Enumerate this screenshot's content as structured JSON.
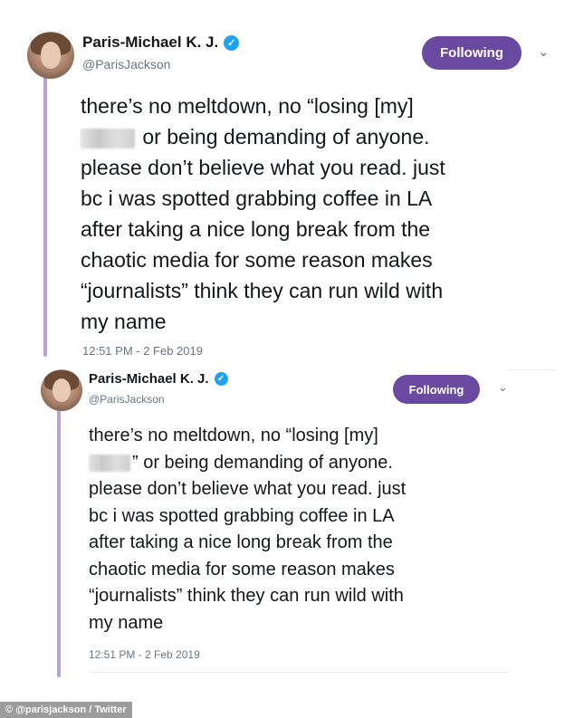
{
  "tweets": [
    {
      "display_name": "Paris-Michael K. J.",
      "handle": "@ParisJackson",
      "follow_label": "Following",
      "lines": [
        "there’s no meltdown, no “losing [my]",
        " or being demanding of anyone.",
        "please don’t believe what you read. just",
        "bc i was spotted grabbing coffee in LA",
        "after taking a nice long break from the",
        "chaotic media for some reason makes",
        "“journalists” think they can run wild with",
        "my name"
      ],
      "timestamp": "12:51 PM - 2 Feb 2019"
    },
    {
      "display_name": "Paris-Michael K. J.",
      "handle": "@ParisJackson",
      "follow_label": "Following",
      "lines": [
        "there’s no meltdown, no “losing [my]",
        "” or being demanding of anyone.",
        "please don’t believe what you read. just",
        "bc i was spotted grabbing coffee in LA",
        "after taking a nice long break from the",
        "chaotic media for some reason makes",
        "“journalists” think they can run wild with",
        "my name"
      ],
      "timestamp": "12:51 PM - 2 Feb 2019"
    }
  ],
  "credit": "© @parisjackson / Twitter",
  "icons": {
    "verified": "verified-badge-icon",
    "chevron": "chevron-down-icon"
  },
  "colors": {
    "follow_button": "#6a4aa0",
    "verified": "#1da1f2",
    "thread_line": "#b5a3d1"
  }
}
